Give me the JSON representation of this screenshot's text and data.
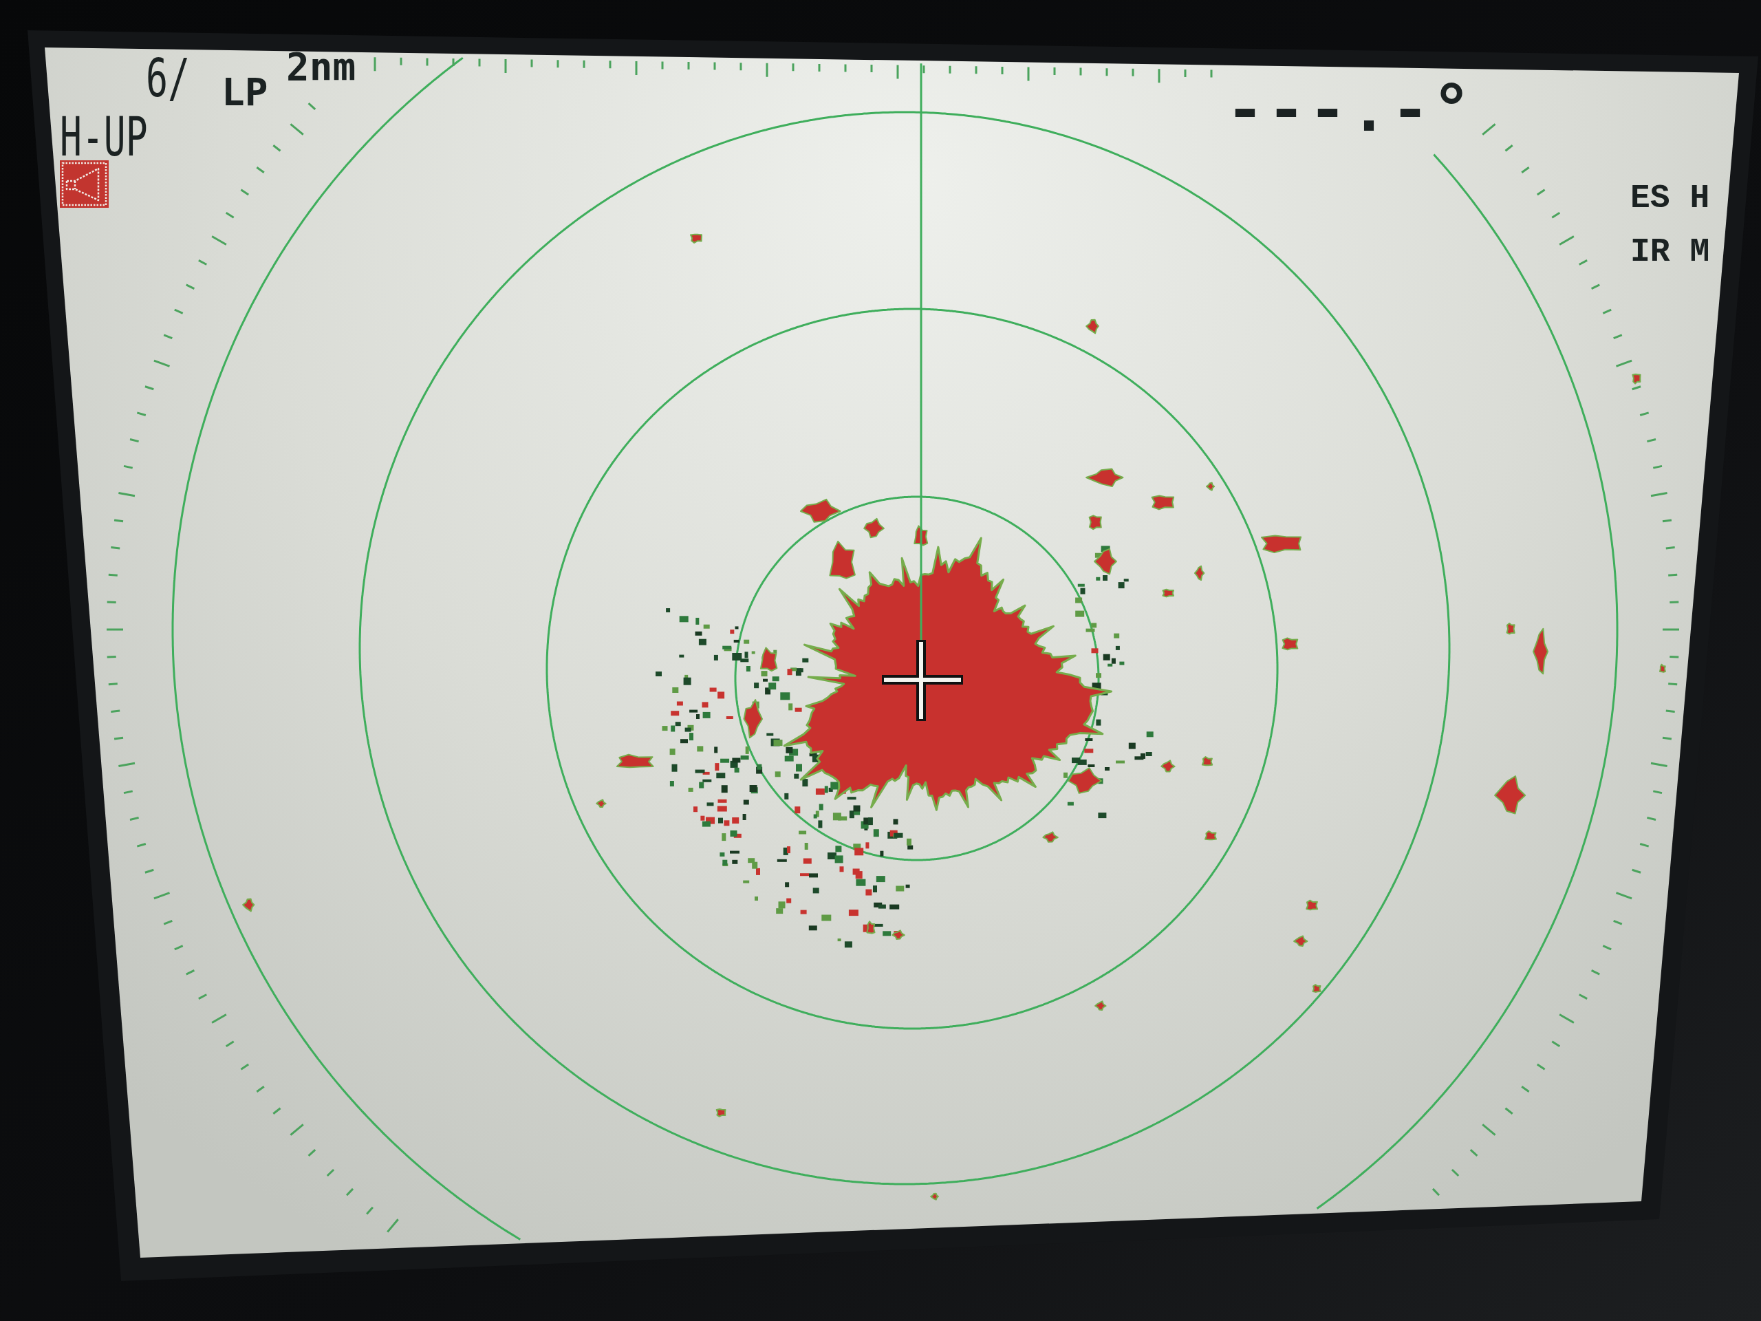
{
  "header": {
    "range_scale": "6/",
    "pulse_length": "LP",
    "ring_interval": "2nm"
  },
  "orientation_mode": "H-UP",
  "heading_readout": "---.-°",
  "side_labels": [
    "ES H",
    "IR M"
  ]
}
